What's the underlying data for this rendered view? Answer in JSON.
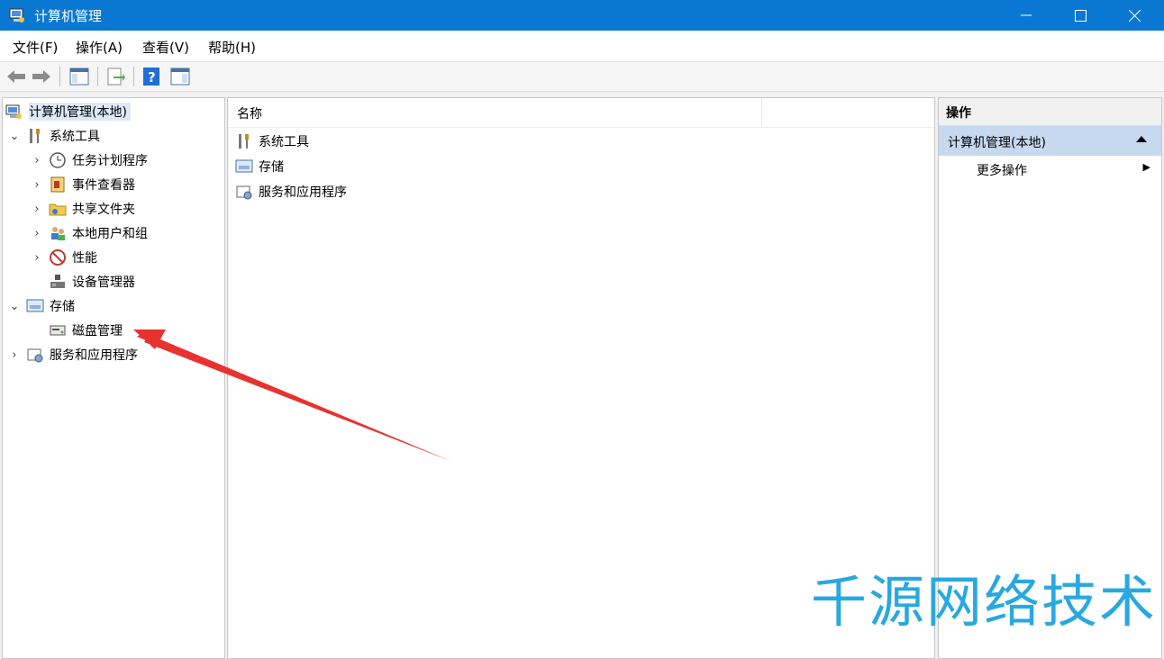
{
  "window": {
    "title": "计算机管理"
  },
  "menu": [
    "文件(F)",
    "操作(A)",
    "查看(V)",
    "帮助(H)"
  ],
  "tree": {
    "root": "计算机管理(本地)",
    "system_tools": "系统工具",
    "task_scheduler": "任务计划程序",
    "event_viewer": "事件查看器",
    "shared_folders": "共享文件夹",
    "local_users": "本地用户和组",
    "performance": "性能",
    "device_manager": "设备管理器",
    "storage": "存储",
    "disk_management": "磁盘管理",
    "services_apps": "服务和应用程序"
  },
  "list": {
    "column": "名称",
    "items": [
      "系统工具",
      "存储",
      "服务和应用程序"
    ]
  },
  "actions": {
    "header": "操作",
    "selected": "计算机管理(本地)",
    "more": "更多操作"
  },
  "watermark": "千源网络技术",
  "colors": {
    "titlebar": "#0a78d2",
    "annotation_arrow": "#e8322f",
    "watermark": "#29a8e0"
  }
}
